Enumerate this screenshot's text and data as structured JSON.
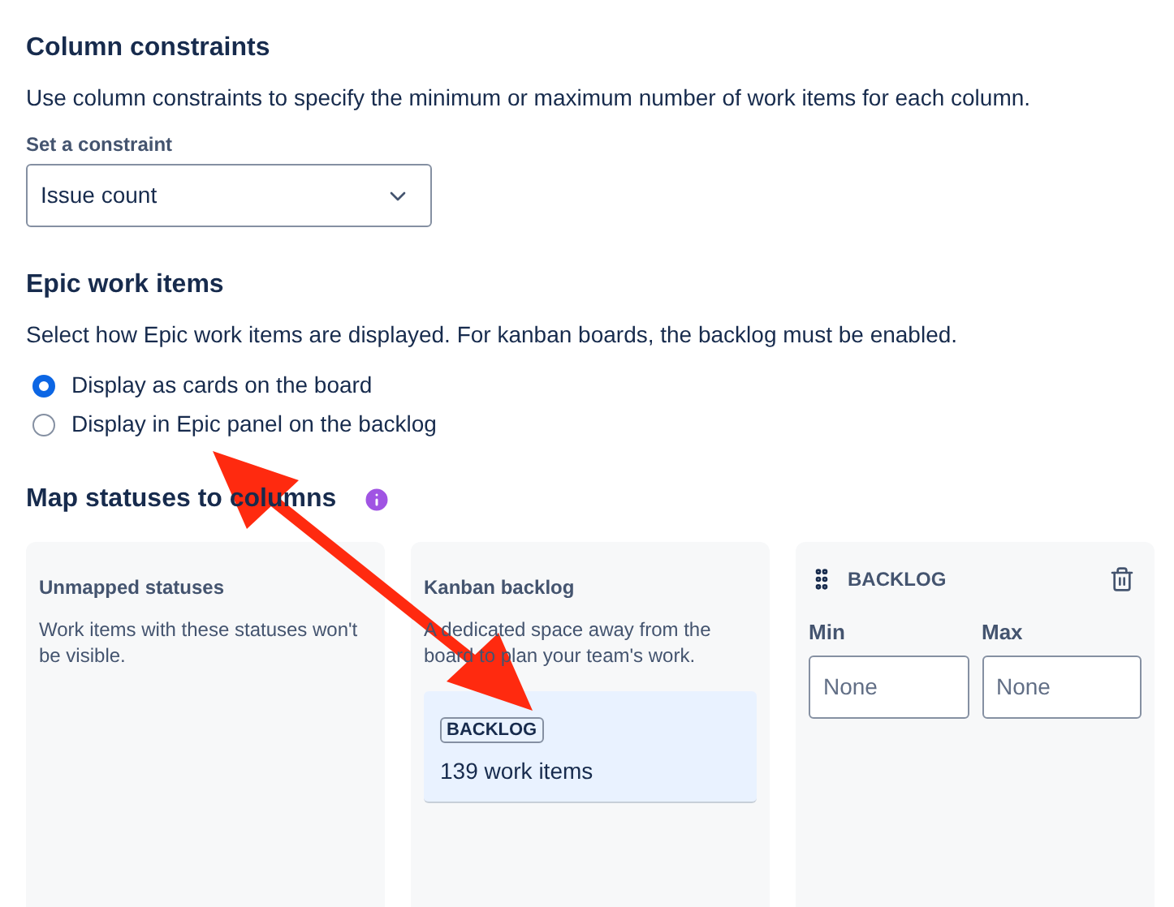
{
  "column_constraints": {
    "title": "Column constraints",
    "description": "Use column constraints to specify the minimum or maximum number of work items for each column.",
    "select_label": "Set a constraint",
    "select_value": "Issue count"
  },
  "epic_work_items": {
    "title": "Epic work items",
    "description": "Select how Epic work items are displayed. For kanban boards, the backlog must be enabled.",
    "options": [
      {
        "label": "Display as cards on the board",
        "selected": true
      },
      {
        "label": "Display in Epic panel on the backlog",
        "selected": false
      }
    ]
  },
  "map_statuses": {
    "title": "Map statuses to columns",
    "columns": [
      {
        "kind": "unmapped",
        "title": "Unmapped statuses",
        "description": "Work items with these statuses won't be visible."
      },
      {
        "kind": "backlog",
        "title": "Kanban backlog",
        "description": "A dedicated space away from the board to plan your team's work.",
        "status": {
          "lozenge": "BACKLOG",
          "count": "139",
          "count_label": "work items"
        }
      },
      {
        "kind": "column",
        "title": "BACKLOG",
        "min": {
          "label": "Min",
          "placeholder": "None"
        },
        "max": {
          "label": "Max",
          "placeholder": "None"
        }
      }
    ]
  }
}
